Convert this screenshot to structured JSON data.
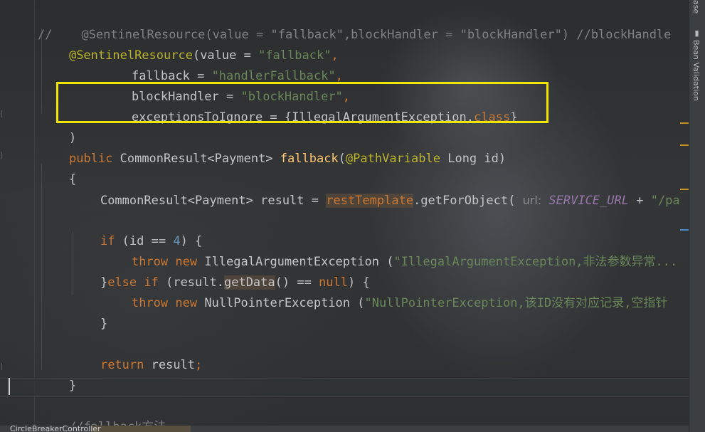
{
  "editor": {
    "lines": {
      "l1": {
        "prefix": "//    ",
        "text": "@SentinelResource(value = \"fallback\",blockHandler = \"blockHandler\") //blockHandle"
      },
      "l2": {
        "ann": "@SentinelResource",
        "p1": "(value = ",
        "s1": "\"fallback\"",
        "p2": ","
      },
      "l3": {
        "a": "fallback",
        "b": " = ",
        "s": "\"handlerFallback\"",
        "c": ","
      },
      "l4": {
        "a": "blockHandler",
        "b": " = ",
        "s": "\"blockHandler\"",
        "c": ","
      },
      "l5": {
        "a": "exceptionsToIgnore",
        "b": " = {IllegalArgumentException.",
        "kw": "class",
        "c": "}"
      },
      "l6": {
        "a": ")"
      },
      "l7": {
        "kw": "public",
        "t": " CommonResult<Payment> ",
        "fn": "fallback",
        "p": "(",
        "ann": "@PathVariable",
        "rest": " Long id)"
      },
      "l8": {
        "a": "{"
      },
      "l9": {
        "t": "CommonResult<Payment> result = ",
        "hl": "restTemplate",
        "m": ".getForObject( ",
        "hint": "url:",
        "fld": " SERVICE_URL",
        "plus": " + ",
        "s": "\"/pa"
      },
      "l10": {
        "kw": "if",
        "t": " (id == ",
        "num": "4",
        "c": ") {"
      },
      "l11": {
        "kw1": "throw",
        "kw2": " new",
        "t": " IllegalArgumentException (",
        "s": "\"IllegalArgumentException,非法参数异常..."
      },
      "l12": {
        "a": "}",
        "kw1": "else if",
        "t": " (result.",
        "hl": "getData",
        "m": "() == ",
        "kw2": "null",
        "c": ") {"
      },
      "l13": {
        "kw1": "throw",
        "kw2": " new",
        "t": " NullPointerException (",
        "s": "\"NullPointerException,该ID没有对应记录,空指针"
      },
      "l14": {
        "a": "}"
      },
      "l15": {
        "kw": "return",
        "t": " result",
        "semi": ";"
      },
      "l16": {
        "a": "}"
      },
      "l17": {
        "cmt": "//fallback方法"
      }
    }
  },
  "right_panel": {
    "top_label": "ase",
    "bean_validation": "Bean Validation"
  },
  "status": {
    "file_label": "CircleBreakerController"
  },
  "colors": {
    "highlight_box": "#f2e600",
    "keyword": "#cc7832",
    "string": "#6a8759",
    "annotation": "#bbb529",
    "number": "#6897bb"
  }
}
